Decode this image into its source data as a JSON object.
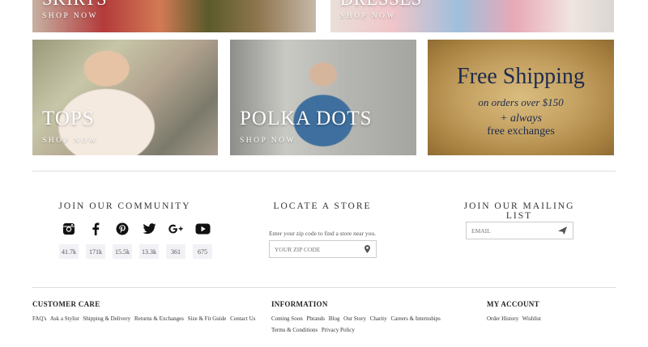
{
  "tiles": {
    "skirts": {
      "title": "SKIRTS",
      "sub": "SHOP NOW"
    },
    "dresses": {
      "title": "DRESSES",
      "sub": "SHOP NOW"
    },
    "tops": {
      "title": "TOPS",
      "sub": "SHOP NOW"
    },
    "polka": {
      "title": "POLKA DOTS",
      "sub": "SHOP NOW"
    },
    "shipping": {
      "line1": "Free Shipping",
      "line2": "on orders over $150",
      "line3": "+ always",
      "line4": "free exchanges"
    }
  },
  "community": {
    "heading": "JOIN OUR COMMUNITY",
    "networks": [
      {
        "icon": "instagram-icon",
        "count": "41.7k"
      },
      {
        "icon": "facebook-icon",
        "count": "171k"
      },
      {
        "icon": "pinterest-icon",
        "count": "15.5k"
      },
      {
        "icon": "twitter-icon",
        "count": "13.3k"
      },
      {
        "icon": "google-plus-icon",
        "count": "361"
      },
      {
        "icon": "youtube-icon",
        "count": "675"
      }
    ]
  },
  "store": {
    "heading": "LOCATE A STORE",
    "description": "Enter your zip code to find a store near you.",
    "zip_placeholder": "YOUR ZIP CODE"
  },
  "mailing": {
    "heading": "JOIN OUR MAILING LIST",
    "email_placeholder": "EMAIL"
  },
  "footer": {
    "customer_care": {
      "heading": "CUSTOMER CARE",
      "links": [
        "FAQ's",
        "Ask a Stylist",
        "Shipping & Delivery",
        "Returns & Exchanges",
        "Size & Fit Guide",
        "Contact Us"
      ]
    },
    "information": {
      "heading": "INFORMATION",
      "links": [
        "Coming Soon",
        "Pbrands",
        "Blog",
        "Our Story",
        "Charity",
        "Careers & Internships",
        "Terms & Conditions",
        "Privacy Policy"
      ]
    },
    "account": {
      "heading": "MY ACCOUNT",
      "links": [
        "Order History",
        "Wishlist"
      ]
    }
  }
}
